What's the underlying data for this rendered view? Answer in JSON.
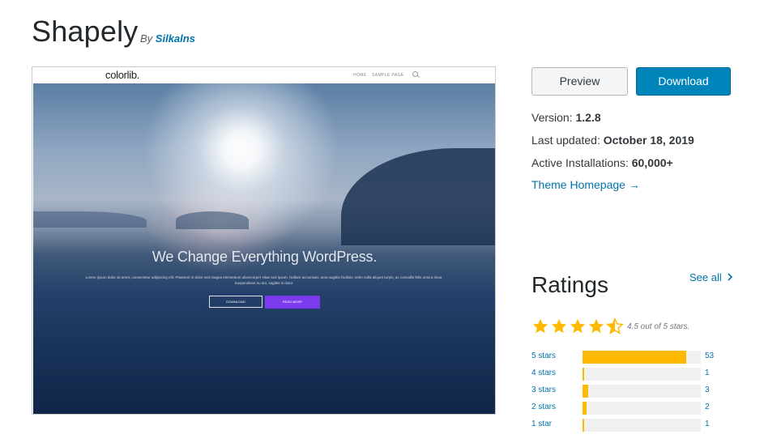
{
  "theme": {
    "title": "Shapely",
    "by_prefix": "By",
    "author": "Silkalns"
  },
  "screenshot": {
    "logo": "colorlib.",
    "nav": [
      "HOME",
      "SAMPLE PAGE"
    ],
    "hero_title": "We Change Everything WordPress.",
    "hero_text": "Lorem ipsum dolor sit amet, consectetur adipiscing elit. Praesent in dolor sed magna elementum ullamcorper vitae sed ipsum. Nullam accumsan, urna sagittis facilisis, enim nulla aliquet turpis, ac convallis felis urna a risus. Suspendisse eu dui, sagittis in dolor.",
    "btn_download": "DOWNLOAD",
    "btn_read_more": "READ MORE"
  },
  "actions": {
    "preview": "Preview",
    "download": "Download"
  },
  "meta": {
    "version_label": "Version:",
    "version": "1.2.8",
    "updated_label": "Last updated:",
    "updated": "October 18, 2019",
    "installs_label": "Active Installations:",
    "installs": "60,000+",
    "homepage_link": "Theme Homepage →"
  },
  "ratings": {
    "title": "Ratings",
    "see_all": "See all",
    "see_all_icon": "chevron-right-icon",
    "average": 4.5,
    "average_text": "4.5 out of 5 stars.",
    "star_color": "#ffb900",
    "rows": [
      {
        "label": "5 stars",
        "count": "53",
        "fraction": 0.88
      },
      {
        "label": "4 stars",
        "count": "1",
        "fraction": 0.017
      },
      {
        "label": "3 stars",
        "count": "3",
        "fraction": 0.05
      },
      {
        "label": "2 stars",
        "count": "2",
        "fraction": 0.034
      },
      {
        "label": "1 star",
        "count": "1",
        "fraction": 0.017
      }
    ]
  },
  "colors": {
    "link": "#0073aa",
    "primary_button": "#0085ba",
    "rating_fill": "#ffb900"
  }
}
